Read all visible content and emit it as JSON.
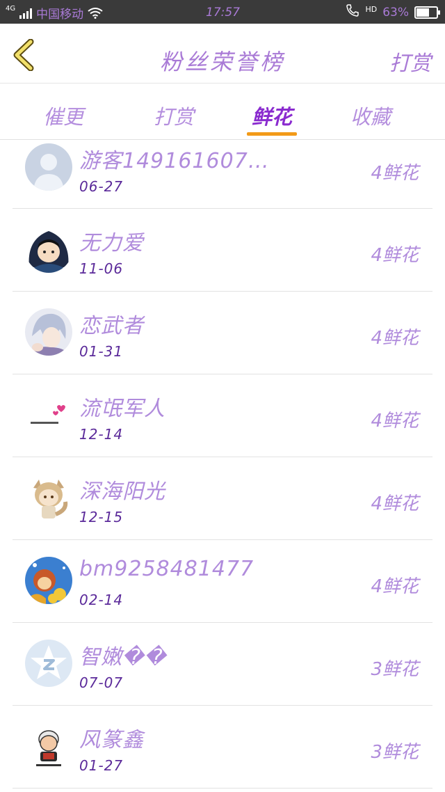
{
  "status_bar": {
    "network": "4G",
    "carrier": "中国移动",
    "time": "17:57",
    "hd": "HD",
    "battery": "63%",
    "battery_level": 0.63
  },
  "header": {
    "title": "粉丝荣誉榜",
    "action": "打赏",
    "back_icon": "chevron-left-icon"
  },
  "tabs": [
    {
      "label": "催更",
      "active": false
    },
    {
      "label": "打赏",
      "active": false
    },
    {
      "label": "鲜花",
      "active": true
    },
    {
      "label": "收藏",
      "active": false
    }
  ],
  "list": [
    {
      "name": "游客149161607…",
      "date": "06-27",
      "amount": "4鲜花",
      "avatar": "default-user-icon"
    },
    {
      "name": "无力爱",
      "date": "11-06",
      "amount": "4鲜花",
      "avatar": "hooded-character-avatar"
    },
    {
      "name": "恋武者",
      "date": "01-31",
      "amount": "4鲜花",
      "avatar": "anime-boy-avatar"
    },
    {
      "name": "流氓军人",
      "date": "12-14",
      "amount": "4鲜花",
      "avatar": "text-hearts-avatar"
    },
    {
      "name": "深海阳光",
      "date": "12-15",
      "amount": "4鲜花",
      "avatar": "chibi-fox-avatar"
    },
    {
      "name": "bm9258481477",
      "date": "02-14",
      "amount": "4鲜花",
      "avatar": "cartoon-monkey-avatar"
    },
    {
      "name": "智嫩��",
      "date": "07-07",
      "amount": "3鲜花",
      "avatar": "qzone-star-avatar"
    },
    {
      "name": "风篆鑫",
      "date": "01-27",
      "amount": "3鲜花",
      "avatar": "cartoon-man-avatar"
    }
  ],
  "colors": {
    "accent_purple": "#a97ad6",
    "active_tab": "#8a2bcf",
    "indicator": "#f29a18",
    "date": "#5b2a9a"
  }
}
